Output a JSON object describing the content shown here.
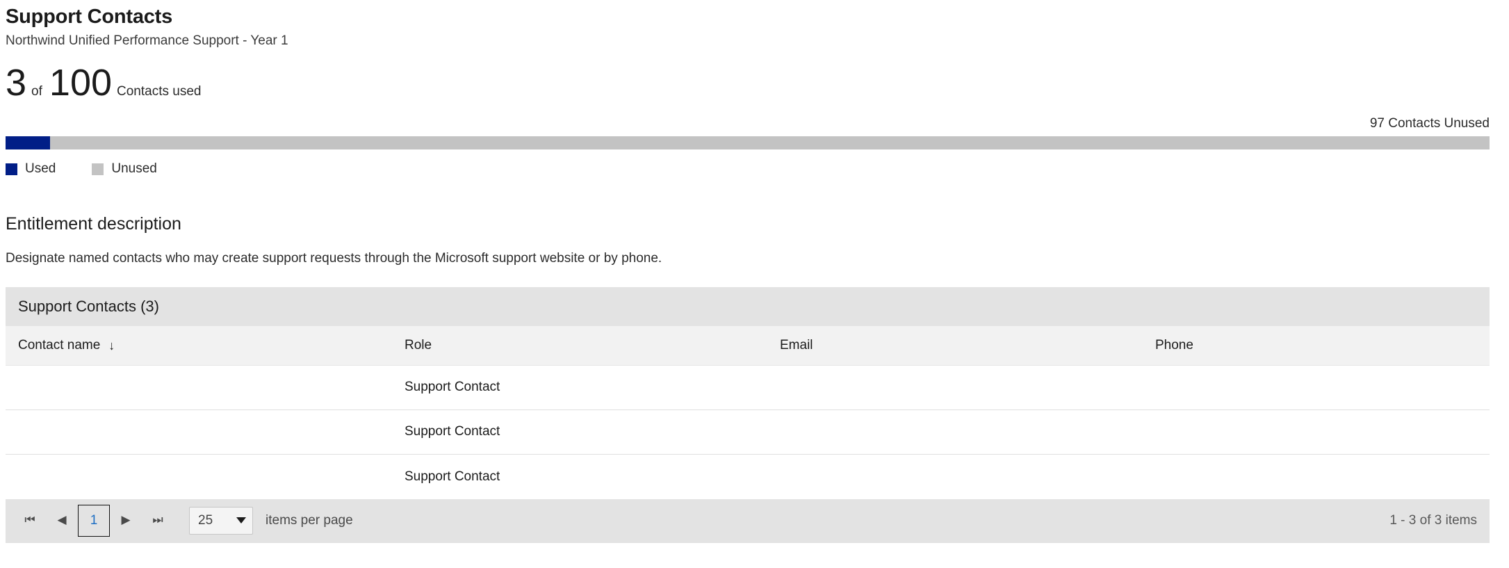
{
  "header": {
    "title": "Support Contacts",
    "subtitle": "Northwind Unified Performance Support - Year 1"
  },
  "metric": {
    "used": "3",
    "of_label": "of",
    "total": "100",
    "unit_label": "Contacts used"
  },
  "usage_bar": {
    "unused_caption": "97 Contacts Unused",
    "used_percent": 3,
    "used_color": "#011e87",
    "unused_color": "#c3c3c3"
  },
  "legend": {
    "items": [
      {
        "label": "Used",
        "color": "#011e87"
      },
      {
        "label": "Unused",
        "color": "#c3c3c3"
      }
    ]
  },
  "entitlement": {
    "title": "Entitlement description",
    "body": "Designate named contacts who may create support requests through the Microsoft support website or by phone."
  },
  "grid": {
    "toolbar_title": "Support Contacts (3)",
    "columns": [
      {
        "label": "Contact name",
        "sorted": true,
        "sort_arrow": "↓"
      },
      {
        "label": "Role",
        "sorted": false
      },
      {
        "label": "Email",
        "sorted": false
      },
      {
        "label": "Phone",
        "sorted": false
      }
    ],
    "rows": [
      {
        "contact_name": "",
        "role": "Support Contact",
        "email": "",
        "phone": ""
      },
      {
        "contact_name": "",
        "role": "Support Contact",
        "email": "",
        "phone": ""
      },
      {
        "contact_name": "",
        "role": "Support Contact",
        "email": "",
        "phone": ""
      }
    ]
  },
  "pager": {
    "first_icon": "⏮",
    "prev_icon": "◀",
    "current_page": "1",
    "next_icon": "▶",
    "last_icon": "⏭",
    "page_size": "25",
    "page_size_label": "items per page",
    "range_text": "1 - 3 of 3 items"
  }
}
